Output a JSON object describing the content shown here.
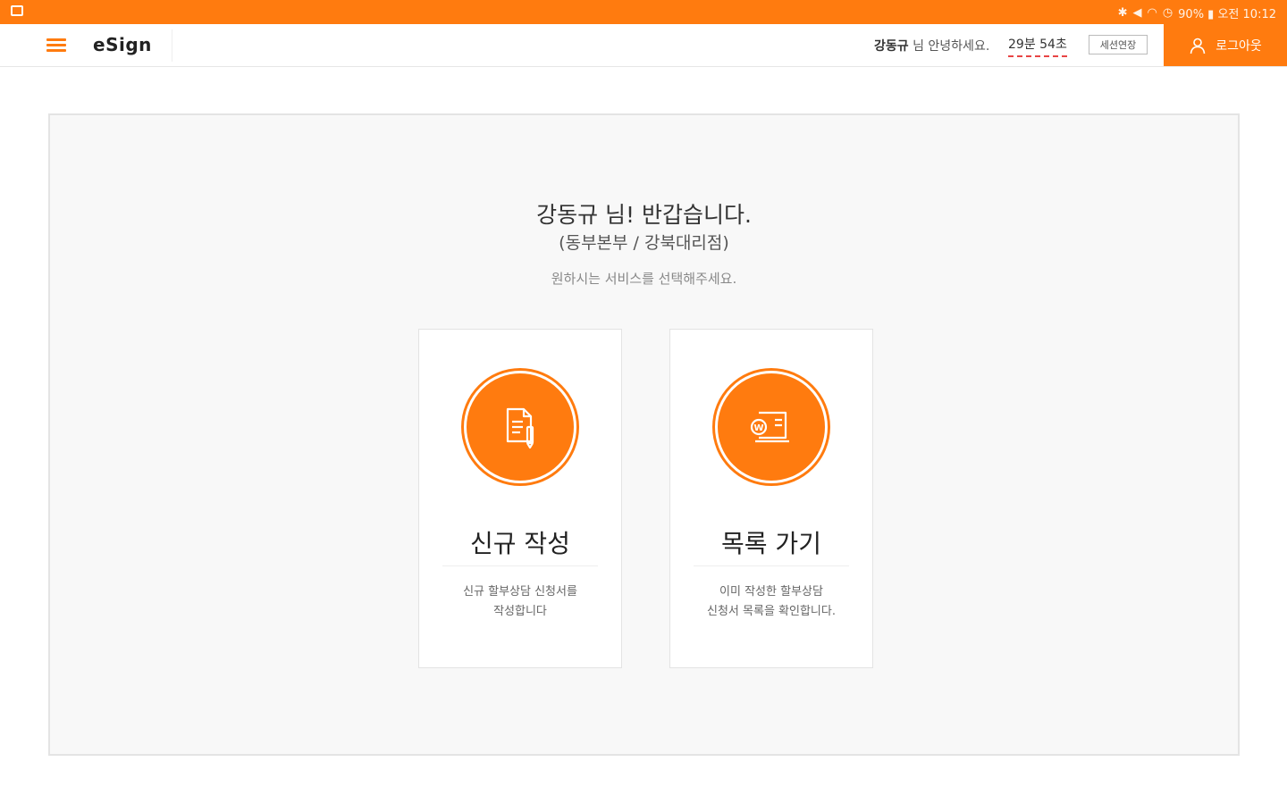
{
  "statusbar": {
    "right_text": "90% ▮ 오전 10:12"
  },
  "appbar": {
    "brand": "eSign",
    "greeting_name": "강동규",
    "greeting_suffix": " 님 안녕하세요.",
    "timer": "29분 54초",
    "extend_label": "세션연장",
    "logout_label": "로그아웃"
  },
  "welcome": {
    "title": "강동규 님! 반갑습니다.",
    "subtitle": "(동부본부 / 강북대리점)",
    "prompt": "원하시는 서비스를 선택해주세요."
  },
  "cards": [
    {
      "title": "신규 작성",
      "desc_line1": "신규 할부상담 신청서를",
      "desc_line2": "작성합니다"
    },
    {
      "title": "목록 가기",
      "desc_line1": "이미 작성한 할부상담",
      "desc_line2": "신청서 목록을 확인합니다."
    }
  ],
  "colors": {
    "accent": "#ff7b0f",
    "panel_bg": "#f8f8f8"
  }
}
